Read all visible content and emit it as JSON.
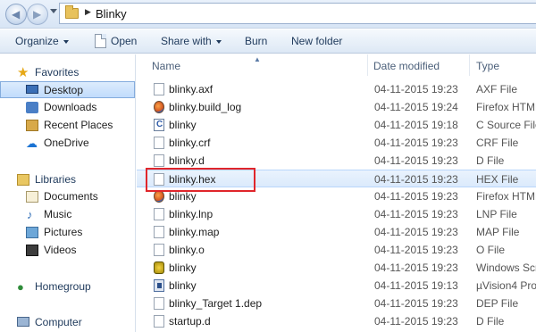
{
  "address": {
    "crumb": "Blinky"
  },
  "toolbar": {
    "organize": "Organize",
    "open": "Open",
    "share_with": "Share with",
    "burn": "Burn",
    "new_folder": "New folder"
  },
  "nav": {
    "favorites": "Favorites",
    "desktop": "Desktop",
    "downloads": "Downloads",
    "recent_places": "Recent Places",
    "onedrive": "OneDrive",
    "libraries": "Libraries",
    "documents": "Documents",
    "music": "Music",
    "pictures": "Pictures",
    "videos": "Videos",
    "homegroup": "Homegroup",
    "computer": "Computer"
  },
  "columns": {
    "name": "Name",
    "date_modified": "Date modified",
    "type": "Type"
  },
  "files": [
    {
      "name": "blinky.axf",
      "date": "04-11-2015 19:23",
      "type": "AXF File",
      "icon": "file-icon"
    },
    {
      "name": "blinky.build_log",
      "date": "04-11-2015 19:24",
      "type": "Firefox HTML",
      "icon": "firefox-icon"
    },
    {
      "name": "blinky",
      "date": "04-11-2015 19:18",
      "type": "C Source File",
      "icon": "c-source-icon"
    },
    {
      "name": "blinky.crf",
      "date": "04-11-2015 19:23",
      "type": "CRF File",
      "icon": "file-icon"
    },
    {
      "name": "blinky.d",
      "date": "04-11-2015 19:23",
      "type": "D File",
      "icon": "file-icon"
    },
    {
      "name": "blinky.hex",
      "date": "04-11-2015 19:23",
      "type": "HEX File",
      "icon": "file-icon"
    },
    {
      "name": "blinky",
      "date": "04-11-2015 19:23",
      "type": "Firefox HTML",
      "icon": "firefox-icon"
    },
    {
      "name": "blinky.lnp",
      "date": "04-11-2015 19:23",
      "type": "LNP File",
      "icon": "file-icon"
    },
    {
      "name": "blinky.map",
      "date": "04-11-2015 19:23",
      "type": "MAP File",
      "icon": "file-icon"
    },
    {
      "name": "blinky.o",
      "date": "04-11-2015 19:23",
      "type": "O File",
      "icon": "file-icon"
    },
    {
      "name": "blinky",
      "date": "04-11-2015 19:23",
      "type": "Windows Scri",
      "icon": "batch-script-icon"
    },
    {
      "name": "blinky",
      "date": "04-11-2015 19:13",
      "type": "µVision4 Proj",
      "icon": "uvision-project-icon"
    },
    {
      "name": "blinky_Target 1.dep",
      "date": "04-11-2015 19:23",
      "type": "DEP File",
      "icon": "file-icon"
    },
    {
      "name": "startup.d",
      "date": "04-11-2015 19:23",
      "type": "D File",
      "icon": "file-icon"
    }
  ],
  "colors": {
    "highlight_box": "#e0262b",
    "selection": "#c1dcfc"
  }
}
